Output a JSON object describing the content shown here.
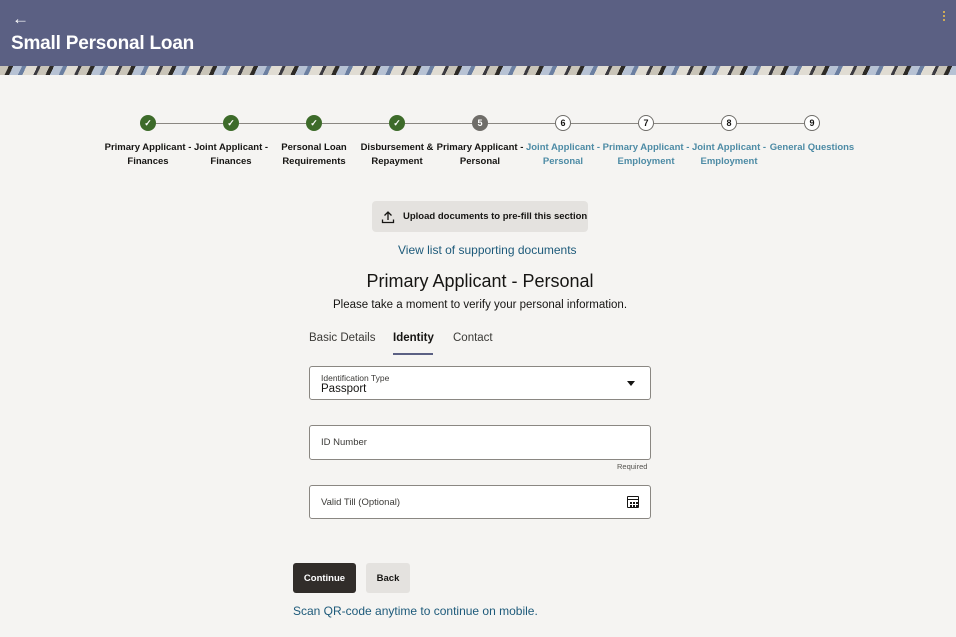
{
  "header": {
    "back_icon": "arrow-left-icon",
    "title": "Small Personal Loan",
    "menu_icon": "kebab-menu-icon",
    "accent": "#5b6083"
  },
  "stepper": {
    "steps": [
      {
        "number": "1",
        "label": "Primary Applicant - Finances",
        "state": "done"
      },
      {
        "number": "2",
        "label": "Joint Applicant - Finances",
        "state": "done"
      },
      {
        "number": "3",
        "label": "Personal Loan Requirements",
        "state": "done"
      },
      {
        "number": "4",
        "label": "Disbursement & Repayment",
        "state": "done"
      },
      {
        "number": "5",
        "label": "Primary Applicant - Personal",
        "state": "current"
      },
      {
        "number": "6",
        "label": "Joint Applicant - Personal",
        "state": "todo"
      },
      {
        "number": "7",
        "label": "Primary Applicant - Employment",
        "state": "todo"
      },
      {
        "number": "8",
        "label": "Joint Applicant - Employment",
        "state": "todo"
      },
      {
        "number": "9",
        "label": "General Questions",
        "state": "todo"
      }
    ]
  },
  "upload": {
    "icon": "upload-icon",
    "label": "Upload documents to pre-fill this section"
  },
  "supporting_docs_link": "View list of supporting documents",
  "section": {
    "title": "Primary Applicant - Personal",
    "subtitle": "Please take a moment to verify your personal information."
  },
  "tabs": [
    {
      "label": "Basic Details",
      "active": false
    },
    {
      "label": "Identity",
      "active": true
    },
    {
      "label": "Contact",
      "active": false
    }
  ],
  "form": {
    "id_type": {
      "label": "Identification Type",
      "value": "Passport"
    },
    "id_number": {
      "placeholder": "ID Number",
      "helper": "Required"
    },
    "valid_till": {
      "placeholder": "Valid Till (Optional)",
      "icon": "calendar-icon"
    }
  },
  "actions": {
    "continue": "Continue",
    "back": "Back"
  },
  "qr_link": "Scan QR-code anytime to continue on mobile."
}
